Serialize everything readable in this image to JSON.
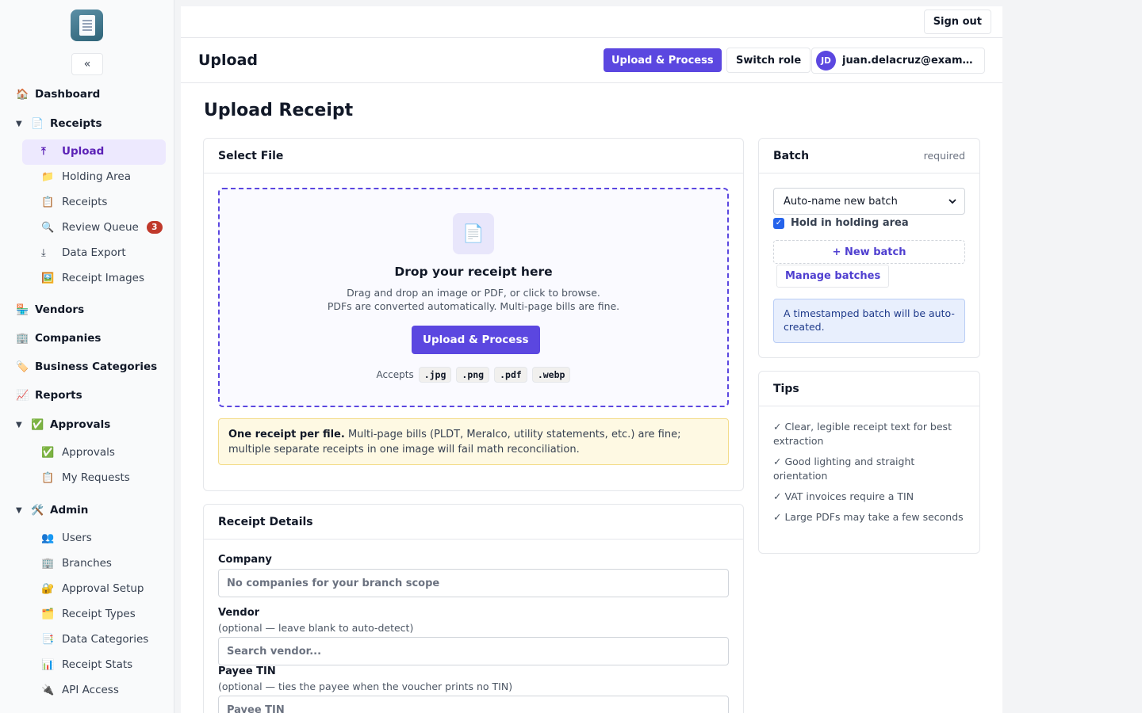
{
  "sidebar": {
    "collapse": "«",
    "top_items": [
      {
        "icon": "🏠",
        "label": "Dashboard"
      }
    ],
    "receipts_group": {
      "caret": "▼",
      "icon": "📄",
      "label": "Receipts",
      "items": [
        {
          "icon": "⤒",
          "label": "Upload"
        },
        {
          "icon": "📁",
          "label": "Holding Area"
        },
        {
          "icon": "📋",
          "label": "Receipts"
        },
        {
          "icon": "🔍",
          "label": "Review Queue",
          "badge": "3"
        },
        {
          "icon": "⤓",
          "label": "Data Export"
        },
        {
          "icon": "🖼️",
          "label": "Receipt Images"
        }
      ]
    },
    "mid_items": [
      {
        "icon": "🏪",
        "label": "Vendors"
      },
      {
        "icon": "🏢",
        "label": "Companies"
      },
      {
        "icon": "🏷️",
        "label": "Business Categories"
      },
      {
        "icon": "📈",
        "label": "Reports"
      }
    ],
    "approvals_group": {
      "caret": "▼",
      "icon": "✅",
      "label": "Approvals",
      "items": [
        {
          "icon": "✅",
          "label": "Approvals"
        },
        {
          "icon": "📋",
          "label": "My Requests"
        }
      ]
    },
    "admin_group": {
      "caret": "▼",
      "icon": "🛠️",
      "label": "Admin",
      "items": [
        {
          "icon": "👥",
          "label": "Users"
        },
        {
          "icon": "🏢",
          "label": "Branches"
        },
        {
          "icon": "🔐",
          "label": "Approval Setup"
        },
        {
          "icon": "🗂️",
          "label": "Receipt Types"
        },
        {
          "icon": "📑",
          "label": "Data Categories"
        },
        {
          "icon": "📊",
          "label": "Receipt Stats"
        },
        {
          "icon": "🔌",
          "label": "API Access"
        }
      ]
    }
  },
  "topbar": {
    "sign_out": "Sign out"
  },
  "header": {
    "title": "Upload",
    "primary_button": "Upload & Process",
    "switch_role": "Switch role",
    "user_initials": "JD",
    "user_email": "juan.delacruz@exampl..."
  },
  "main": {
    "title": "Upload Receipt",
    "select_file": {
      "heading": "Select File",
      "drop_icon": "📄",
      "drop_title": "Drop your receipt here",
      "drop_line1": "Drag and drop an image or PDF, or click to browse.",
      "drop_line2": "PDFs are converted automatically. Multi-page bills are fine.",
      "button": "Upload & Process",
      "accepts_label": "Accepts",
      "accepts": [
        ".jpg",
        ".png",
        ".pdf",
        ".webp"
      ],
      "notice_bold": "One receipt per file.",
      "notice_text": " Multi-page bills (PLDT, Meralco, utility statements, etc.) are fine; multiple separate receipts in one image will fail math reconciliation."
    },
    "receipt_details": {
      "heading": "Receipt Details",
      "company_label": "Company",
      "company_value": "No companies for your branch scope",
      "vendor_label": "Vendor",
      "vendor_hint": "(optional — leave blank to auto-detect)",
      "vendor_placeholder": "Search vendor...",
      "tin_label": "Payee TIN",
      "tin_hint": "(optional — ties the payee when the voucher prints no TIN)",
      "tin_placeholder": "Payee TIN"
    },
    "batch": {
      "heading": "Batch",
      "required": "required",
      "select_value": "Auto-name new batch",
      "hold_label": "Hold in holding area",
      "hold_checked": true,
      "new_batch": "+ New batch",
      "manage": "Manage batches",
      "info": "A timestamped batch will be auto-created."
    },
    "tips": {
      "heading": "Tips",
      "items": [
        "✓  Clear, legible receipt text for best extraction",
        "✓  Good lighting and straight orientation",
        "✓  VAT invoices require a TIN",
        "✓  Large PDFs may take a few seconds"
      ]
    }
  }
}
